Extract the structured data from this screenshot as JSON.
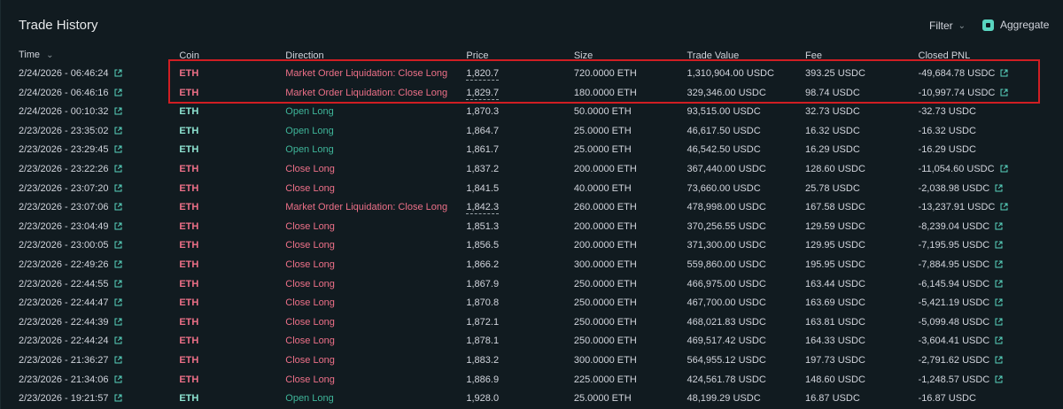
{
  "header": {
    "title": "Trade History"
  },
  "controls": {
    "filter_label": "Filter",
    "aggregate_label": "Aggregate",
    "aggregate_checked": true
  },
  "columns": [
    "Time",
    "Coin",
    "Direction",
    "Price",
    "Size",
    "Trade Value",
    "Fee",
    "Closed PNL"
  ],
  "colors": {
    "sell": "#ed7088",
    "buy": "#3fb69a",
    "accent": "#59d5c0",
    "highlight": "#d01e23"
  },
  "rows": [
    {
      "time": "2/24/2026 - 06:46:24",
      "coin": "ETH",
      "direction": "Market Order Liquidation: Close Long",
      "price": "1,820.7",
      "size": "720.0000 ETH",
      "value": "1,310,904.00 USDC",
      "fee": "393.25 USDC",
      "pnl": "-49,684.78 USDC",
      "side": "sell",
      "pnl_link": true,
      "price_dotted": true
    },
    {
      "time": "2/24/2026 - 06:46:16",
      "coin": "ETH",
      "direction": "Market Order Liquidation: Close Long",
      "price": "1,829.7",
      "size": "180.0000 ETH",
      "value": "329,346.00 USDC",
      "fee": "98.74 USDC",
      "pnl": "-10,997.74 USDC",
      "side": "sell",
      "pnl_link": true,
      "price_dotted": true
    },
    {
      "time": "2/24/2026 - 00:10:32",
      "coin": "ETH",
      "direction": "Open Long",
      "price": "1,870.3",
      "size": "50.0000 ETH",
      "value": "93,515.00 USDC",
      "fee": "32.73 USDC",
      "pnl": "-32.73 USDC",
      "side": "buy",
      "pnl_link": false,
      "price_dotted": false
    },
    {
      "time": "2/23/2026 - 23:35:02",
      "coin": "ETH",
      "direction": "Open Long",
      "price": "1,864.7",
      "size": "25.0000 ETH",
      "value": "46,617.50 USDC",
      "fee": "16.32 USDC",
      "pnl": "-16.32 USDC",
      "side": "buy",
      "pnl_link": false,
      "price_dotted": false
    },
    {
      "time": "2/23/2026 - 23:29:45",
      "coin": "ETH",
      "direction": "Open Long",
      "price": "1,861.7",
      "size": "25.0000 ETH",
      "value": "46,542.50 USDC",
      "fee": "16.29 USDC",
      "pnl": "-16.29 USDC",
      "side": "buy",
      "pnl_link": false,
      "price_dotted": false
    },
    {
      "time": "2/23/2026 - 23:22:26",
      "coin": "ETH",
      "direction": "Close Long",
      "price": "1,837.2",
      "size": "200.0000 ETH",
      "value": "367,440.00 USDC",
      "fee": "128.60 USDC",
      "pnl": "-11,054.60 USDC",
      "side": "sell",
      "pnl_link": true,
      "price_dotted": false
    },
    {
      "time": "2/23/2026 - 23:07:20",
      "coin": "ETH",
      "direction": "Close Long",
      "price": "1,841.5",
      "size": "40.0000 ETH",
      "value": "73,660.00 USDC",
      "fee": "25.78 USDC",
      "pnl": "-2,038.98 USDC",
      "side": "sell",
      "pnl_link": true,
      "price_dotted": false
    },
    {
      "time": "2/23/2026 - 23:07:06",
      "coin": "ETH",
      "direction": "Market Order Liquidation: Close Long",
      "price": "1,842.3",
      "size": "260.0000 ETH",
      "value": "478,998.00 USDC",
      "fee": "167.58 USDC",
      "pnl": "-13,237.91 USDC",
      "side": "sell",
      "pnl_link": true,
      "price_dotted": true
    },
    {
      "time": "2/23/2026 - 23:04:49",
      "coin": "ETH",
      "direction": "Close Long",
      "price": "1,851.3",
      "size": "200.0000 ETH",
      "value": "370,256.55 USDC",
      "fee": "129.59 USDC",
      "pnl": "-8,239.04 USDC",
      "side": "sell",
      "pnl_link": true,
      "price_dotted": false
    },
    {
      "time": "2/23/2026 - 23:00:05",
      "coin": "ETH",
      "direction": "Close Long",
      "price": "1,856.5",
      "size": "200.0000 ETH",
      "value": "371,300.00 USDC",
      "fee": "129.95 USDC",
      "pnl": "-7,195.95 USDC",
      "side": "sell",
      "pnl_link": true,
      "price_dotted": false
    },
    {
      "time": "2/23/2026 - 22:49:26",
      "coin": "ETH",
      "direction": "Close Long",
      "price": "1,866.2",
      "size": "300.0000 ETH",
      "value": "559,860.00 USDC",
      "fee": "195.95 USDC",
      "pnl": "-7,884.95 USDC",
      "side": "sell",
      "pnl_link": true,
      "price_dotted": false
    },
    {
      "time": "2/23/2026 - 22:44:55",
      "coin": "ETH",
      "direction": "Close Long",
      "price": "1,867.9",
      "size": "250.0000 ETH",
      "value": "466,975.00 USDC",
      "fee": "163.44 USDC",
      "pnl": "-6,145.94 USDC",
      "side": "sell",
      "pnl_link": true,
      "price_dotted": false
    },
    {
      "time": "2/23/2026 - 22:44:47",
      "coin": "ETH",
      "direction": "Close Long",
      "price": "1,870.8",
      "size": "250.0000 ETH",
      "value": "467,700.00 USDC",
      "fee": "163.69 USDC",
      "pnl": "-5,421.19 USDC",
      "side": "sell",
      "pnl_link": true,
      "price_dotted": false
    },
    {
      "time": "2/23/2026 - 22:44:39",
      "coin": "ETH",
      "direction": "Close Long",
      "price": "1,872.1",
      "size": "250.0000 ETH",
      "value": "468,021.83 USDC",
      "fee": "163.81 USDC",
      "pnl": "-5,099.48 USDC",
      "side": "sell",
      "pnl_link": true,
      "price_dotted": false
    },
    {
      "time": "2/23/2026 - 22:44:24",
      "coin": "ETH",
      "direction": "Close Long",
      "price": "1,878.1",
      "size": "250.0000 ETH",
      "value": "469,517.42 USDC",
      "fee": "164.33 USDC",
      "pnl": "-3,604.41 USDC",
      "side": "sell",
      "pnl_link": true,
      "price_dotted": false
    },
    {
      "time": "2/23/2026 - 21:36:27",
      "coin": "ETH",
      "direction": "Close Long",
      "price": "1,883.2",
      "size": "300.0000 ETH",
      "value": "564,955.12 USDC",
      "fee": "197.73 USDC",
      "pnl": "-2,791.62 USDC",
      "side": "sell",
      "pnl_link": true,
      "price_dotted": false
    },
    {
      "time": "2/23/2026 - 21:34:06",
      "coin": "ETH",
      "direction": "Close Long",
      "price": "1,886.9",
      "size": "225.0000 ETH",
      "value": "424,561.78 USDC",
      "fee": "148.60 USDC",
      "pnl": "-1,248.57 USDC",
      "side": "sell",
      "pnl_link": true,
      "price_dotted": false
    },
    {
      "time": "2/23/2026 - 19:21:57",
      "coin": "ETH",
      "direction": "Open Long",
      "price": "1,928.0",
      "size": "25.0000 ETH",
      "value": "48,199.29 USDC",
      "fee": "16.87 USDC",
      "pnl": "-16.87 USDC",
      "side": "buy",
      "pnl_link": false,
      "price_dotted": false
    }
  ]
}
